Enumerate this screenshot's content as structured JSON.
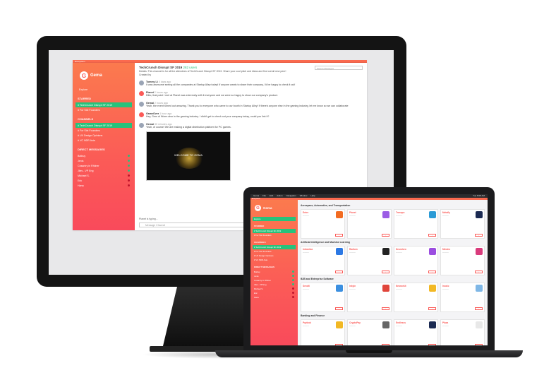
{
  "imac": {
    "strip_label": "Ecosystem",
    "workspace_name": "Gema",
    "explore_label": "Explore",
    "sections": {
      "starred": "STARRED",
      "channels": "CHANNELS",
      "direct": "DIRECT MESSAGES"
    },
    "starred": [
      {
        "label": "TechCrunch Disrupt SF 2019",
        "active": true
      },
      {
        "label": "For Sixt Founders",
        "active": false
      }
    ],
    "channels": [
      {
        "label": "TechCrunch Disrupt SF 2019",
        "active": true
      },
      {
        "label": "For Sixt Founders",
        "active": false
      },
      {
        "label": "UX Design Opinions",
        "active": false
      },
      {
        "label": "VC NDR Asia",
        "active": false
      }
    ],
    "direct": [
      {
        "label": "Botbuy",
        "color": "#27c27b"
      },
      {
        "label": "Jenis",
        "color": "#27c27b"
      },
      {
        "label": "Cosantry in Rhilner",
        "color": "#27c27b"
      },
      {
        "label": "Jiles - VP Eng",
        "color": "#27c27b"
      },
      {
        "label": "Michael S.",
        "color": "#c0152c"
      },
      {
        "label": "Eric",
        "color": "#c0152c"
      },
      {
        "label": "Hana",
        "color": "#c0152c"
      }
    ],
    "channel_title": "TechCrunch Disrupt SF 2019",
    "channel_members": "282 users",
    "channel_desc": "Details: This channel is for all the attendees of TechCrunch Disrupt SF 2019. Share your cool pitch and ideas and find out all new peer!",
    "created_by": "Created by",
    "search_placeholder": "Search Messages",
    "messages": [
      {
        "name": "Tommy Li",
        "time": "4 days ago",
        "text": "It was awesome seeing all the companies at Startup Alley today! If anyone wants to share their company, I'd be happy to check it out!"
      },
      {
        "name": "Planet",
        "time": "2 hours ago",
        "text": "Ditto, that point I met at Planet was extremely with it everyone and we were so happy to show our company's product."
      },
      {
        "name": "Gemai",
        "time": "2 hours ago",
        "text": "Yeah, the event turned out amazing. Thank you to everyone who came to our booth in Startup Alley! If there's anyone else in the gaming industry, let me know so we can collaborate"
      },
      {
        "name": "GameOver",
        "time": "1 hour ago",
        "text": "Hey, Gem of Worm also in the gaming industry. I didn't get to check out your company today, could you link it?"
      },
      {
        "name": "Gemai",
        "time": "30 minutes ago",
        "text": "Yeah, of course! We are making a digital distribution platform for PC games."
      }
    ],
    "attachment_title": "WELCOME TO GEMA",
    "typing": "Planet is typing...",
    "compose_placeholder": "Message Channel"
  },
  "macbook": {
    "menubar_items": [
      "Gema",
      "File",
      "Edit",
      "Action",
      "Navigation",
      "Window",
      "Help"
    ],
    "menubar_clock": "Tue 8:08 AM",
    "strip_label": "Ecosystem",
    "workspace_name": "Gema",
    "explore_label": "Explore",
    "sections": {
      "starred": "STARRED",
      "channels": "CHANNELS",
      "direct": "DIRECT MESSAGES"
    },
    "categories": [
      {
        "title": "Aerospace, Automotive, and Transportation",
        "cards": [
          {
            "name": "Enter",
            "color": "#f26b21"
          },
          {
            "name": "Planet",
            "color": "#9b5de5"
          },
          {
            "name": "Transpo",
            "color": "#2b9bd6"
          },
          {
            "name": "Metafly",
            "color": "#1b2a52"
          }
        ]
      },
      {
        "title": "Artificial Intelligence and Machine Learning",
        "cards": [
          {
            "name": "Intrastica",
            "color": "#2b78e4"
          },
          {
            "name": "Radium",
            "color": "#222222"
          },
          {
            "name": "Neurobeo",
            "color": "#9b4de0"
          },
          {
            "name": "Mindeo",
            "color": "#d93b7c"
          }
        ]
      },
      {
        "title": "B2B and Enterprise Software",
        "cards": [
          {
            "name": "Sendit",
            "color": "#3b8fe0"
          },
          {
            "name": "Inkyin",
            "color": "#e0453b"
          },
          {
            "name": "Networkit",
            "color": "#f2b824"
          },
          {
            "name": "Inoxio",
            "color": "#7fb7e6"
          }
        ]
      },
      {
        "title": "Banking and Finance",
        "cards": [
          {
            "name": "Paylock",
            "color": "#f2b824"
          },
          {
            "name": "CryptoPay",
            "color": "#666666"
          },
          {
            "name": "Endlesss",
            "color": "#1b2a52"
          },
          {
            "name": "Plaza",
            "color": "#e8e8e8"
          }
        ]
      }
    ]
  }
}
